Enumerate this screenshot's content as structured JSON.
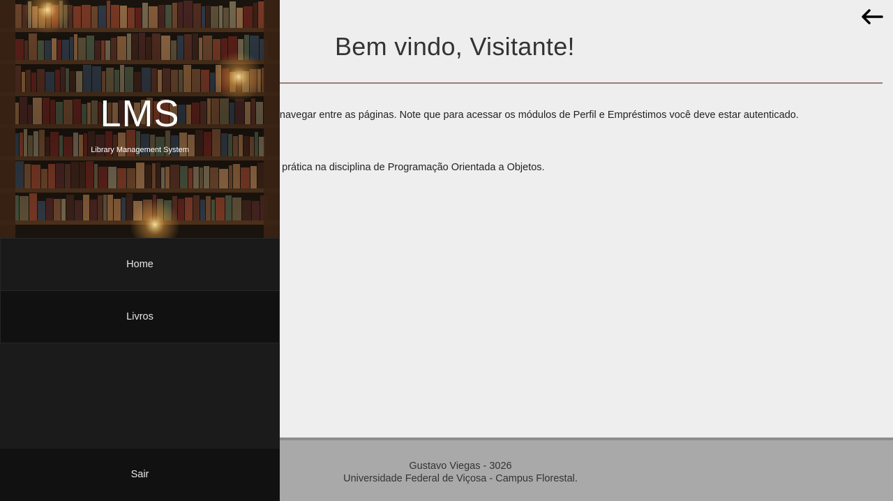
{
  "header": {
    "title": "Bem vindo, Visitante!",
    "back_icon": "arrow-left-icon"
  },
  "main": {
    "paragraph_1": "ra navegar entre as páginas. Note que para acessar os módulos de Perfil e Empréstimos você deve estar autenticado.",
    "paragraph_2": "no prática na disciplina de Programação Orientada a Objetos."
  },
  "sidebar": {
    "logo_title": "LMS",
    "logo_subtitle": "Library Management System",
    "items": [
      {
        "label": "Home"
      },
      {
        "label": "Livros"
      }
    ],
    "logout_label": "Sair"
  },
  "footer": {
    "line1": "Gustavo Viegas - 3026",
    "line2": "Universidade Federal de Viçosa - Campus Florestal."
  },
  "colors": {
    "sidebar_bg": "#1b1b1b",
    "main_bg": "#eeeeee",
    "footer_bg": "#a9a9a9",
    "divider": "#9a7f73"
  }
}
